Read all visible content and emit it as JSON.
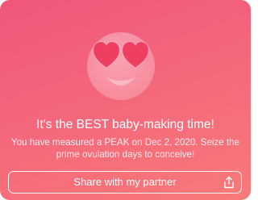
{
  "card": {
    "emoji": "heart-eyes-face-icon",
    "headline": "It's the BEST baby-making time!",
    "body": "You have measured a PEAK on Dec 2, 2020. Seize the prime ovulation days to conceive!",
    "share_button_label": "Share with my partner",
    "share_icon": "share-icon"
  },
  "colors": {
    "gradient_start": "#f0567a",
    "gradient_end": "#f77a78",
    "text": "#ffffff"
  }
}
